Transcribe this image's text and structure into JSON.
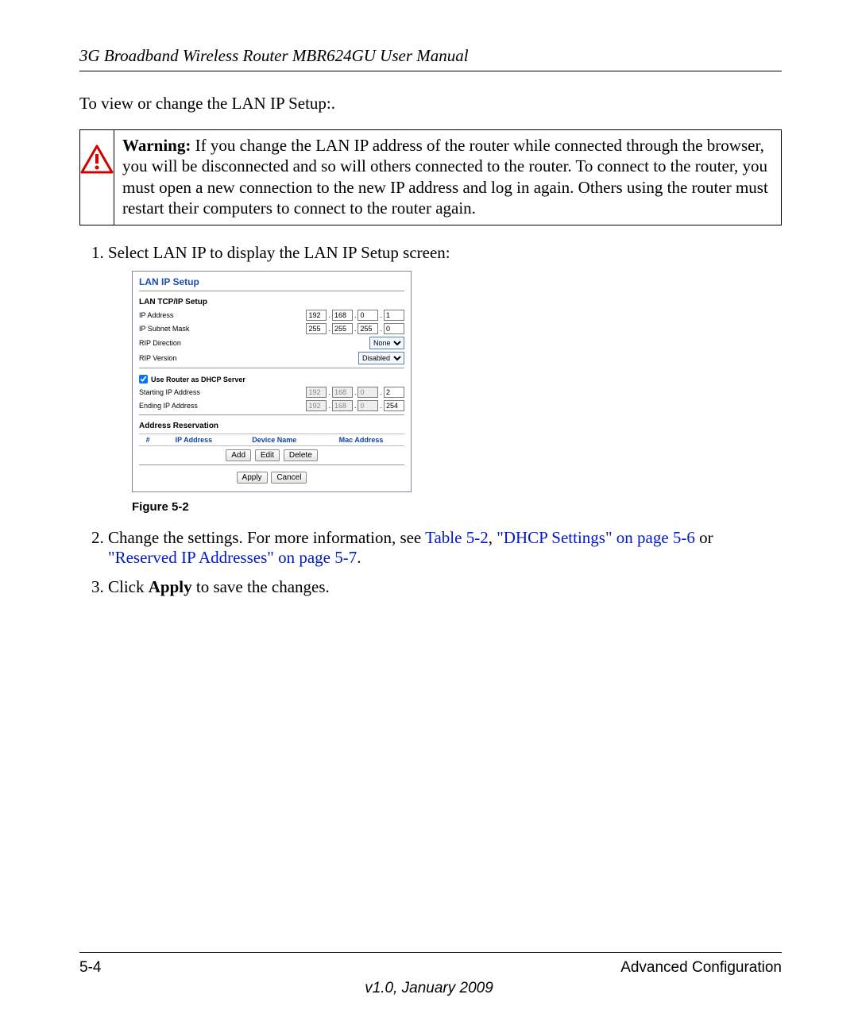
{
  "header": {
    "title": "3G Broadband Wireless Router MBR624GU User Manual"
  },
  "intro": "To view or change the LAN IP Setup:.",
  "warning": {
    "label": "Warning:",
    "text": " If you change the LAN IP address of the router while connected through the browser, you will be disconnected and so will others connected to the router. To connect to the router, you must open a new connection to the new IP address and log in again. Others using the router must restart their computers to connect to the router again."
  },
  "steps": {
    "s1": "Select LAN IP to display the LAN IP Setup screen:",
    "s2a": "Change the settings. For more information, see ",
    "s2_link1": "Table 5-2",
    "s2_link2": "\"DHCP Settings\" on page 5-6",
    "s2_or": " or ",
    "s2_comma": ", ",
    "s2_link3": "\"Reserved IP Addresses\" on page 5-7",
    "s2_period": ".",
    "s3a": "Click ",
    "s3b": "Apply",
    "s3c": " to save the changes."
  },
  "panel": {
    "title": "LAN IP Setup",
    "tcp_head": "LAN TCP/IP Setup",
    "ip_label": "IP Address",
    "ip": [
      "192",
      "168",
      "0",
      "1"
    ],
    "mask_label": "IP Subnet Mask",
    "mask": [
      "255",
      "255",
      "255",
      "0"
    ],
    "ripdir_label": "RIP Direction",
    "ripdir_value": "None",
    "ripver_label": "RIP Version",
    "ripver_value": "Disabled",
    "dhcp_chk": "Use Router as DHCP Server",
    "start_label": "Starting IP Address",
    "start": [
      "192",
      "168",
      "0",
      "2"
    ],
    "end_label": "Ending IP Address",
    "end": [
      "192",
      "168",
      "0",
      "254"
    ],
    "res_head": "Address Reservation",
    "res_cols": {
      "c1": "#",
      "c2": "IP Address",
      "c3": "Device Name",
      "c4": "Mac Address"
    },
    "btns": {
      "add": "Add",
      "edit": "Edit",
      "del": "Delete",
      "apply": "Apply",
      "cancel": "Cancel"
    }
  },
  "figure_caption": "Figure 5-2",
  "footer": {
    "page": "5-4",
    "section": "Advanced Configuration",
    "version": "v1.0, January 2009"
  }
}
